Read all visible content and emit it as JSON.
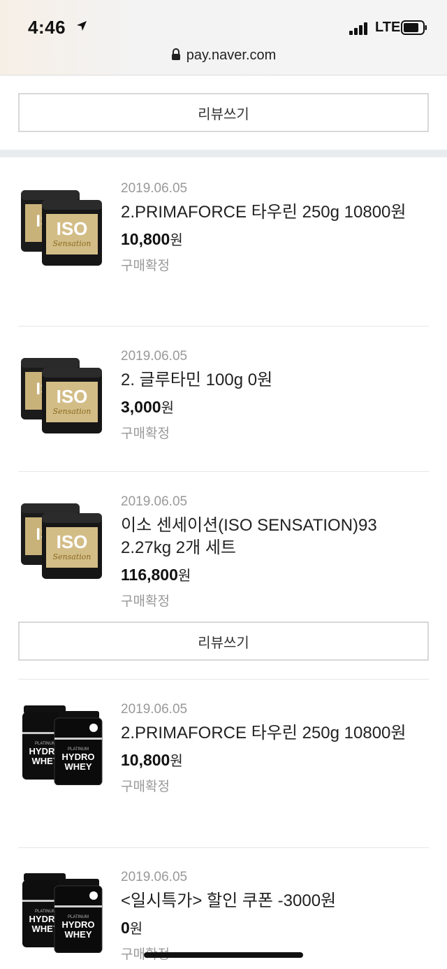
{
  "status_bar": {
    "time": "4:46",
    "network": "LTE",
    "url": "pay.naver.com"
  },
  "review_button_label": "리뷰쓰기",
  "items": [
    {
      "date": "2019.06.05",
      "title": "2.PRIMAFORCE 타우린 250g 10800원",
      "price": "10,800",
      "currency": "원",
      "status": "구매확정",
      "thumbnail": "iso-sensation-tubs"
    },
    {
      "date": "2019.06.05",
      "title": "2. 글루타민 100g 0원",
      "price": "3,000",
      "currency": "원",
      "status": "구매확정",
      "thumbnail": "iso-sensation-tubs"
    },
    {
      "date": "2019.06.05",
      "title": "이소 센세이션(ISO SENSATION)93 2.27kg 2개 세트",
      "price": "116,800",
      "currency": "원",
      "status": "구매확정",
      "thumbnail": "iso-sensation-tubs"
    },
    {
      "date": "2019.06.05",
      "title": "2.PRIMAFORCE 타우린 250g 10800원",
      "price": "10,800",
      "currency": "원",
      "status": "구매확정",
      "thumbnail": "hydro-whey-jars"
    },
    {
      "date": "2019.06.05",
      "title": "<일시특가> 할인 쿠폰 -3000원",
      "price": "0",
      "currency": "원",
      "status": "구매확정",
      "thumbnail": "hydro-whey-jars"
    }
  ],
  "thumbnail_text": {
    "iso_brand": "ISO",
    "iso_sub": "Sensation",
    "hydro_line1": "HYDRO",
    "hydro_line2": "WHEY",
    "hydro_top": "PLATINUM"
  }
}
